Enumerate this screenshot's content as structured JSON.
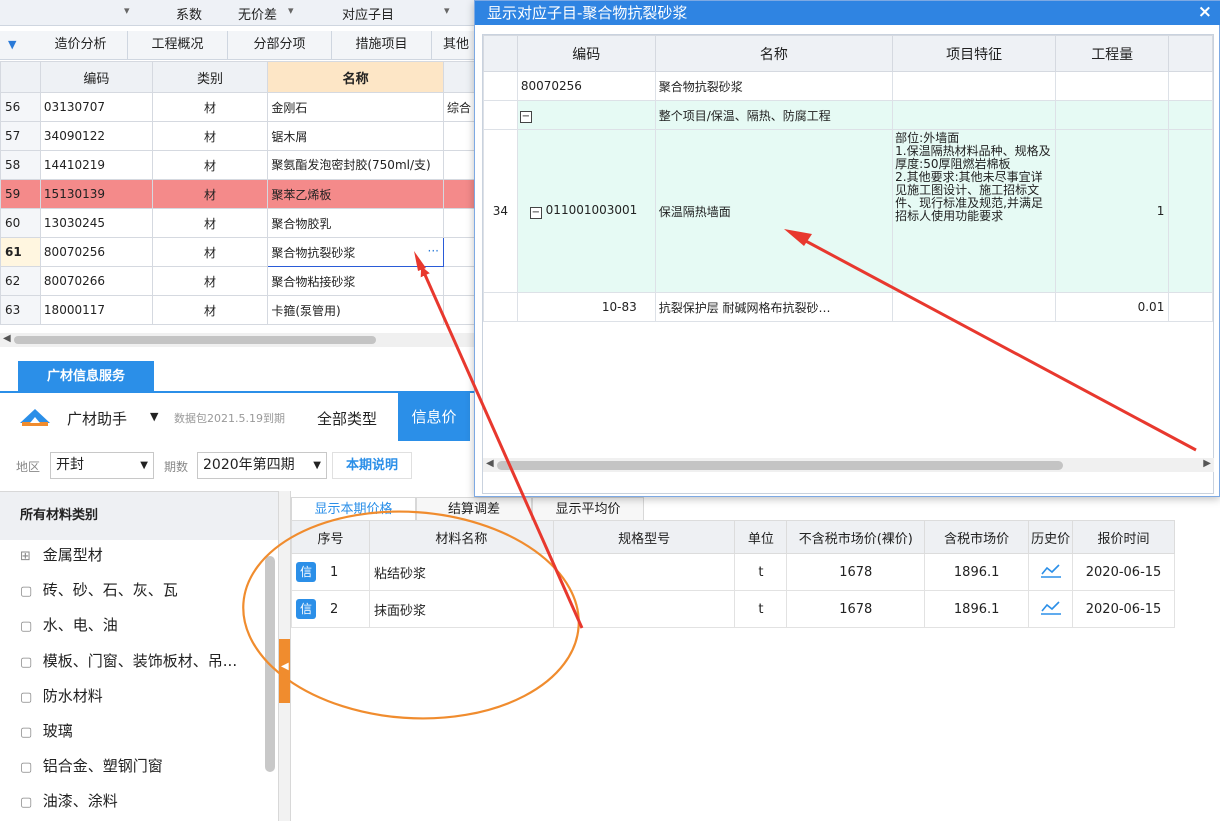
{
  "toolbar": {
    "items": [
      "系数",
      "无价差",
      "对应子目"
    ],
    "dropdown_glyph": "▾"
  },
  "tabs": {
    "items": [
      "造价分析",
      "工程概况",
      "分部分项",
      "措施项目",
      "其他"
    ]
  },
  "grid": {
    "headers": {
      "code": "编码",
      "type": "类别",
      "name": "名称"
    },
    "rows": [
      {
        "num": "56",
        "code": "03130707",
        "type": "材",
        "name": "金刚石",
        "extra": "综合"
      },
      {
        "num": "57",
        "code": "34090122",
        "type": "材",
        "name": "锯木屑",
        "extra": ""
      },
      {
        "num": "58",
        "code": "14410219",
        "type": "材",
        "name": "聚氨酯发泡密封胶(750ml/支)",
        "extra": ""
      },
      {
        "num": "59",
        "code": "15130139",
        "type": "材",
        "name": "聚苯乙烯板",
        "extra": ""
      },
      {
        "num": "60",
        "code": "13030245",
        "type": "材",
        "name": "聚合物胶乳",
        "extra": ""
      },
      {
        "num": "61",
        "code": "80070256",
        "type": "材",
        "name": "聚合物抗裂砂浆",
        "extra": ""
      },
      {
        "num": "62",
        "code": "80070266",
        "type": "材",
        "name": "聚合物粘接砂浆",
        "extra": ""
      },
      {
        "num": "63",
        "code": "18000117",
        "type": "材",
        "name": "卡箍(泵管用)",
        "extra": ""
      }
    ],
    "highlight_color": "#f48a8a"
  },
  "gc": {
    "tab_label": "广材信息服务",
    "assistant": "广材助手",
    "package": "数据包2021.5.19到期",
    "all_types": "全部类型",
    "info_price": "信息价",
    "region_label": "地区",
    "region_value": "开封",
    "period_label": "期数",
    "period_value": "2020年第四期",
    "period_desc": "本期说明"
  },
  "categories": {
    "header": "所有材料类别",
    "items": [
      "金属型材",
      "砖、砂、石、灰、瓦",
      "水、电、油",
      "模板、门窗、装饰板材、吊...",
      "防水材料",
      "玻璃",
      "铝合金、塑钢门窗",
      "油漆、涂料"
    ]
  },
  "price": {
    "subtabs": [
      "显示本期价格",
      "结算调差",
      "显示平均价"
    ],
    "headers": [
      "序号",
      "材料名称",
      "规格型号",
      "单位",
      "不含税市场价(裸价)",
      "含税市场价",
      "历史价",
      "报价时间"
    ],
    "badge": "信",
    "rows": [
      {
        "no": "1",
        "name": "粘结砂浆",
        "spec": "",
        "unit": "t",
        "price_ex": "1678",
        "price_in": "1896.1",
        "date": "2020-06-15"
      },
      {
        "no": "2",
        "name": "抹面砂浆",
        "spec": "",
        "unit": "t",
        "price_ex": "1678",
        "price_in": "1896.1",
        "date": "2020-06-15"
      }
    ]
  },
  "dialog": {
    "title": "显示对应子目-聚合物抗裂砂浆",
    "close": "×",
    "headers": {
      "code": "编码",
      "name": "名称",
      "feature": "项目特征",
      "qty": "工程量"
    },
    "rows": {
      "r1": {
        "code": "80070256",
        "name": "聚合物抗裂砂浆"
      },
      "r2": {
        "name": "整个项目/保温、隔热、防腐工程"
      },
      "r3": {
        "num": "34",
        "code": "011001003001",
        "name": "保温隔热墙面",
        "feature": "部位:外墙面\n1.保温隔热材料品种、规格及厚度:50厚阻燃岩棉板\n2.其他要求:其他未尽事宜详见施工图设计、施工招标文件、现行标准及规范,并满足招标人使用功能要求",
        "qty": "1"
      },
      "r4": {
        "code": "10-83",
        "name": "抗裂保护层 耐碱网格布抗裂砂…",
        "qty": "0.01"
      }
    },
    "title_color": "#2f84e2"
  },
  "colors": {
    "accent": "#2b8fe8",
    "annotation_red": "#e8382e",
    "annotation_orange": "#f08c2e"
  }
}
